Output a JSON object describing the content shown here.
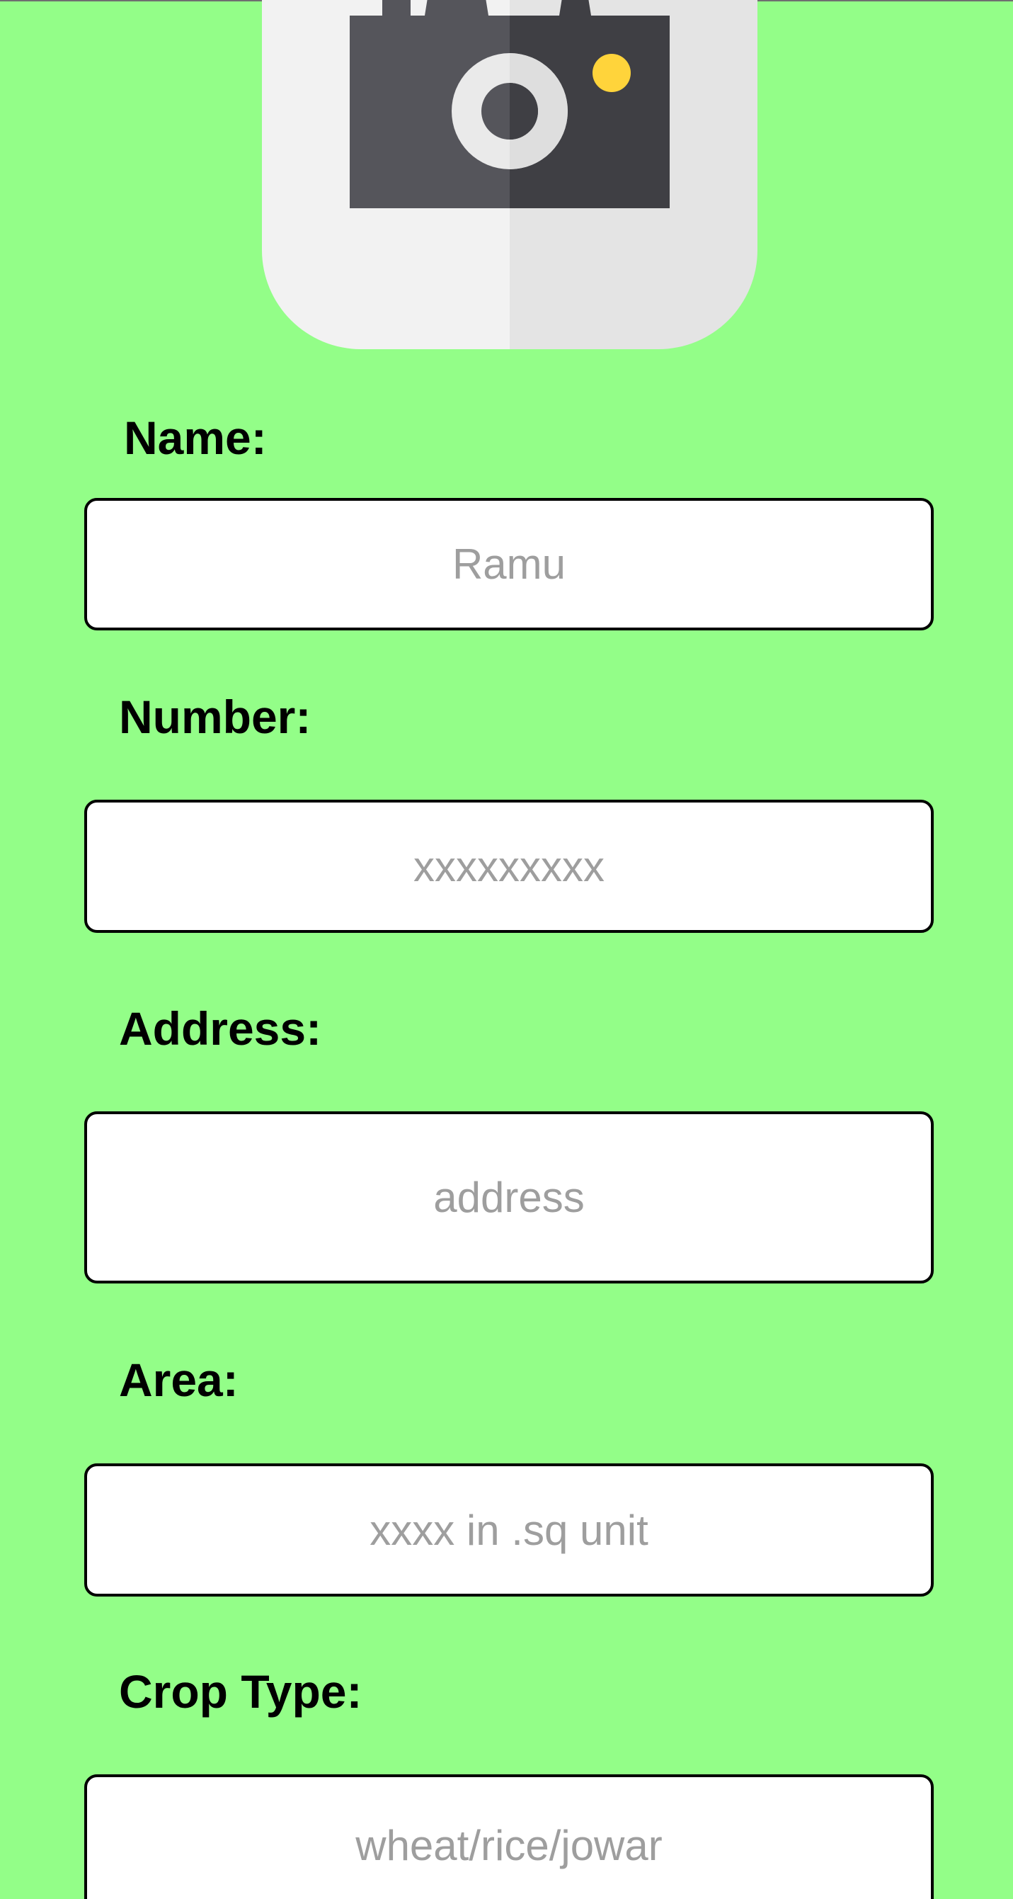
{
  "colors": {
    "background": "#93FE88",
    "field_border": "#000000",
    "field_fill": "#FFFFFF",
    "placeholder": "#9E9E9E",
    "camera_body": "#4A4A50",
    "camera_accent": "#FFD43B",
    "tile": "#F1F1F1"
  },
  "photo": {
    "icon": "camera-icon"
  },
  "form": {
    "name": {
      "label": "Name:",
      "placeholder": "Ramu"
    },
    "number": {
      "label": "Number:",
      "placeholder": "xxxxxxxxx"
    },
    "address": {
      "label": "Address:",
      "placeholder": "address"
    },
    "area": {
      "label": "Area:",
      "placeholder": "xxxx in .sq unit"
    },
    "crop_type": {
      "label": "Crop Type:",
      "placeholder": "wheat/rice/jowar"
    }
  }
}
